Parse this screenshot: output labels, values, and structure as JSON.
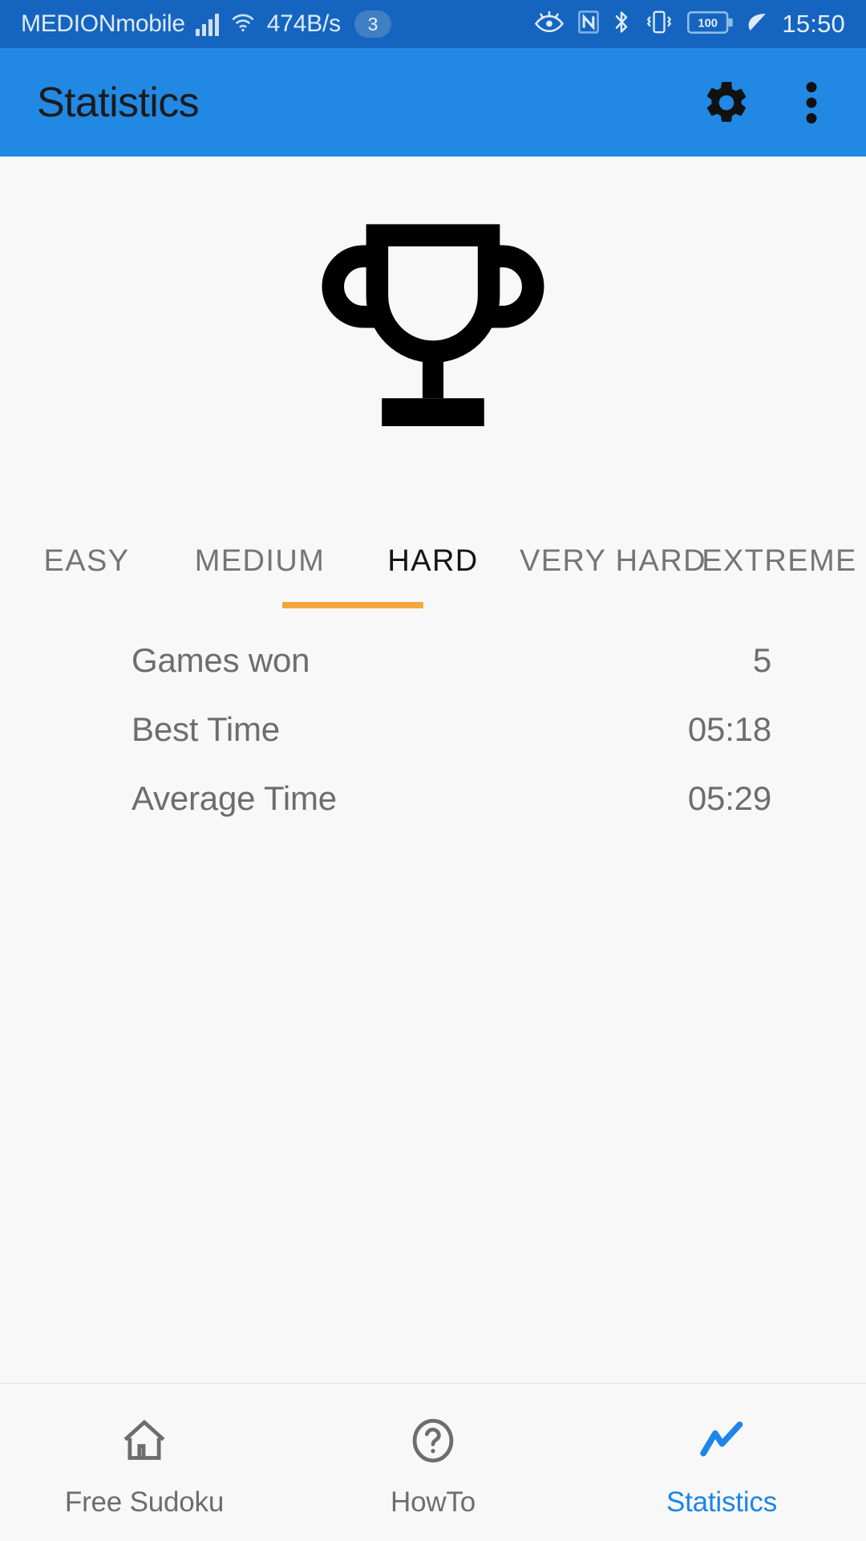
{
  "status_bar": {
    "carrier": "MEDIONmobile",
    "data_rate": "474B/s",
    "notification_count": "3",
    "time": "15:50",
    "battery_level": "100",
    "icons": [
      "signal-bars-icon",
      "wifi-icon",
      "eye-icon",
      "nfc-icon",
      "bluetooth-icon",
      "vibrate-icon",
      "battery-icon",
      "eco-leaf-icon"
    ],
    "background_color": "#1565C0",
    "text_color": "#dfeaf7"
  },
  "app_bar": {
    "title": "Statistics",
    "background_color": "#2189e3",
    "title_color": "#1b1b1b",
    "actions": [
      {
        "name": "settings-button",
        "icon": "gear-icon"
      },
      {
        "name": "overflow-menu-button",
        "icon": "more-vertical-icon"
      }
    ]
  },
  "hero": {
    "icon": "trophy-icon",
    "color": "#000000"
  },
  "tabs": {
    "selected_index": 2,
    "indicator_color": "#f4a73d",
    "active_color": "#141414",
    "inactive_color": "#757575",
    "items": [
      {
        "label": "EASY"
      },
      {
        "label": "MEDIUM"
      },
      {
        "label": "HARD"
      },
      {
        "label": "VERY HARD"
      },
      {
        "label": "EXTREME"
      }
    ]
  },
  "stats": {
    "rows": [
      {
        "label": "Games won",
        "value": "5"
      },
      {
        "label": "Best Time",
        "value": "05:18"
      },
      {
        "label": "Average Time",
        "value": "05:29"
      }
    ]
  },
  "bottom_nav": {
    "active_index": 2,
    "active_color": "#1d86e8",
    "inactive_color": "#6d6d6d",
    "items": [
      {
        "label": "Free Sudoku",
        "icon": "home-icon"
      },
      {
        "label": "HowTo",
        "icon": "help-circle-icon"
      },
      {
        "label": "Statistics",
        "icon": "line-chart-icon"
      }
    ]
  }
}
